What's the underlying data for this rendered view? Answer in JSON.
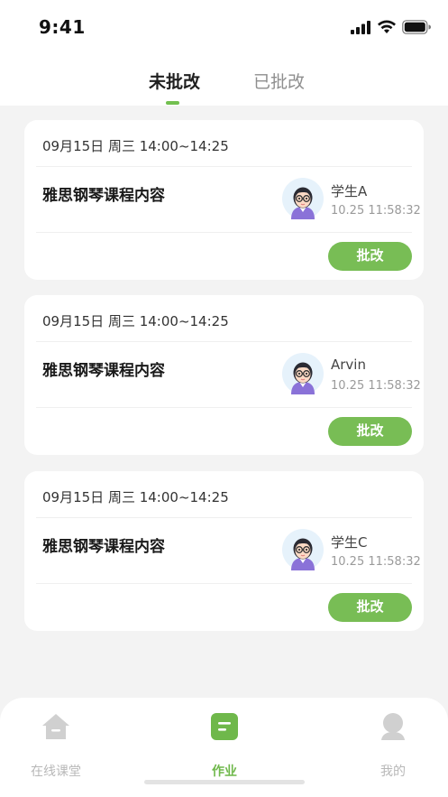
{
  "status_bar": {
    "time": "9:41"
  },
  "tabs": [
    {
      "label": "未批改",
      "active": true
    },
    {
      "label": "已批改",
      "active": false
    }
  ],
  "cards": [
    {
      "date": "09月15日 周三 14:00~14:25",
      "title": "雅思钢琴课程内容",
      "student": "学生A",
      "submitted": "10.25 11:58:32",
      "button": "批改"
    },
    {
      "date": "09月15日 周三 14:00~14:25",
      "title": "雅思钢琴课程内容",
      "student": "Arvin",
      "submitted": "10.25 11:58:32",
      "button": "批改"
    },
    {
      "date": "09月15日 周三 14:00~14:25",
      "title": "雅思钢琴课程内容",
      "student": "学生C",
      "submitted": "10.25 11:58:32",
      "button": "批改"
    }
  ],
  "bottom_nav": [
    {
      "label": "在线课堂",
      "icon": "home-icon",
      "active": false
    },
    {
      "label": "作业",
      "icon": "homework-icon",
      "active": true
    },
    {
      "label": "我的",
      "icon": "profile-icon",
      "active": false
    }
  ],
  "colors": {
    "accent": "#78bd55",
    "background": "#f3f3f3"
  }
}
